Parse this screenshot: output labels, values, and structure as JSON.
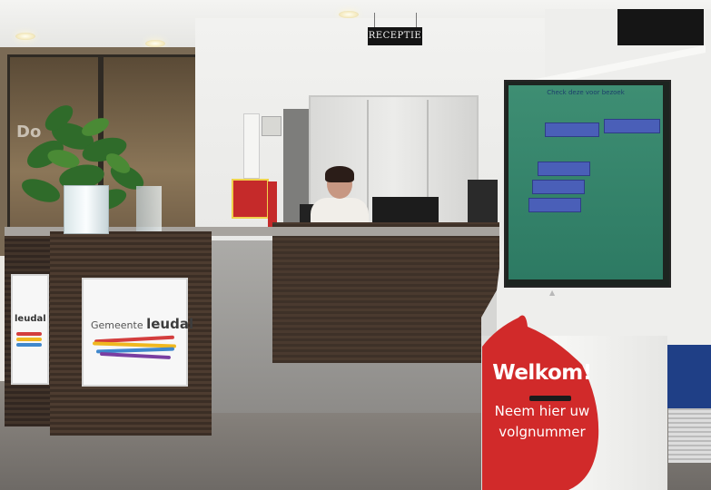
{
  "scene": {
    "reception_sign": "RECEPTIE",
    "kiosk_screen_title": "Check deze voor bezoek",
    "logo": {
      "prefix": "Gemeente",
      "name": "leudal"
    },
    "side_logo": "leudal",
    "kiosk_sticker": {
      "title": "Welkom!",
      "line1": "Neem hier uw",
      "line2": "volgnummer"
    },
    "wall_letters": "Do",
    "colors": {
      "sticker_red": "#d12a2a",
      "screen_green": "#3a8a6f",
      "screen_button": "#4a5fb8"
    }
  }
}
